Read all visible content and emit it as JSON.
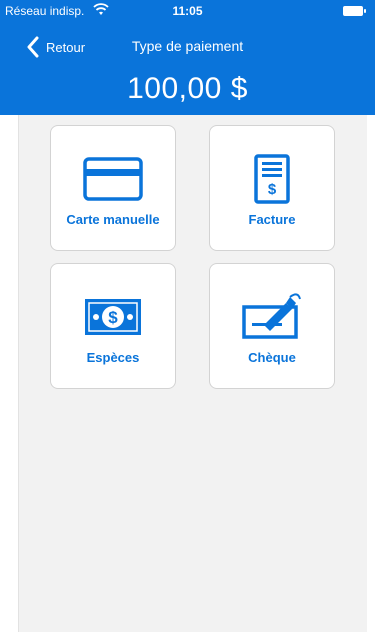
{
  "status": {
    "carrier": "Réseau indisp.",
    "time": "11:05"
  },
  "nav": {
    "back_label": "Retour",
    "title": "Type de paiement"
  },
  "amount": "100,00 $",
  "options": [
    {
      "label": "Carte manuelle",
      "icon": "credit-card-icon"
    },
    {
      "label": "Facture",
      "icon": "invoice-icon"
    },
    {
      "label": "Espèces",
      "icon": "cash-icon"
    },
    {
      "label": "Chèque",
      "icon": "cheque-icon"
    }
  ],
  "colors": {
    "accent": "#0a74da",
    "background": "#f2f2f2"
  }
}
